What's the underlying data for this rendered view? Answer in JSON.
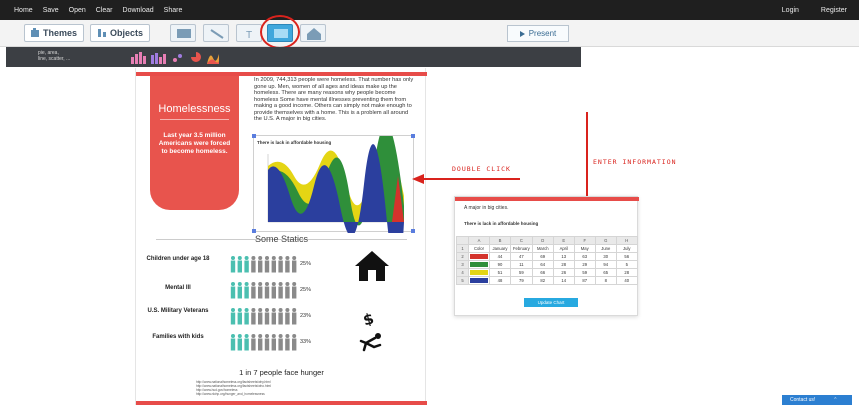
{
  "topbar": {
    "menu": [
      "Home",
      "Save",
      "Open",
      "Clear",
      "Download",
      "Share"
    ],
    "login": "Login",
    "register": "Register"
  },
  "toolbar": {
    "themes_label": "Themes",
    "objects_label": "Objects",
    "present_label": "Present",
    "faded_top": [
      "",
      "",
      ""
    ],
    "faded_bottom": [
      "",
      "",
      ""
    ]
  },
  "subbar": {
    "chart_types_line1": "pie, area,",
    "chart_types_line2": "line, scatter, ..."
  },
  "poster": {
    "badge_title": "Homelessness",
    "badge_text": "Last year 3.5 million Americans were forced to become homeless.",
    "paragraph": "In 2009, 744,313 people were homeless. That number has only gone up. Men, women of all ages and ideas make up the homeless. There are many reasons why people become homeless Some have mental illnesses preventing them from making a good income. Others can simply not make enough to provide themselves with a home. This is a problem all around the U.S. A major in big cities.",
    "chart_caption": "There is lack in affordable housing",
    "section_title": "Some Statics",
    "stats": [
      {
        "label": "Children under age 18",
        "percent": "25%",
        "icon": "house-icon"
      },
      {
        "label": "Mental Ill",
        "percent": "25%",
        "icon": ""
      },
      {
        "label": "U.S. Military Veterans",
        "percent": "23%",
        "icon": "dollar-icon"
      },
      {
        "label": "Families with kids",
        "percent": "33%",
        "icon": "falling-person-icon"
      }
    ],
    "hunger": "1 in 7 people face hunger",
    "references": [
      "http://www.nationalhomeless.org/factsheets/why.html",
      "http://www.nationalhomeless.org/factsheets/who.html",
      "http://www.hud.gov/homeless",
      "http://www.nlchp.org/hunger_and_homelessness"
    ]
  },
  "annotations": {
    "double_click": "DOUBLE CLICK",
    "enter_information": "ENTER INFORMATION"
  },
  "panel": {
    "text": "A major in big cities.",
    "caption": "There is lack in affordable housing",
    "columns": [
      "A",
      "B",
      "C",
      "D",
      "E",
      "F",
      "G",
      "H"
    ],
    "header_row": [
      "Color",
      "January",
      "February",
      "March",
      "April",
      "May",
      "June",
      "July"
    ],
    "rows": [
      {
        "num": "2",
        "color": "#d4332c",
        "values": [
          "44",
          "47",
          "69",
          "13",
          "63",
          "30",
          "56"
        ]
      },
      {
        "num": "3",
        "color": "#2f8f3a",
        "values": [
          "90",
          "11",
          "64",
          "28",
          "29",
          "94",
          "5"
        ]
      },
      {
        "num": "4",
        "color": "#e4d514",
        "values": [
          "51",
          "59",
          "66",
          "26",
          "59",
          "65",
          "28"
        ]
      },
      {
        "num": "5",
        "color": "#2b3f9e",
        "values": [
          "48",
          "79",
          "82",
          "14",
          "87",
          "8",
          "40"
        ]
      }
    ],
    "update_label": "Update Chart"
  },
  "contact": {
    "label": "Contact us!",
    "chevron": "⌃"
  }
}
